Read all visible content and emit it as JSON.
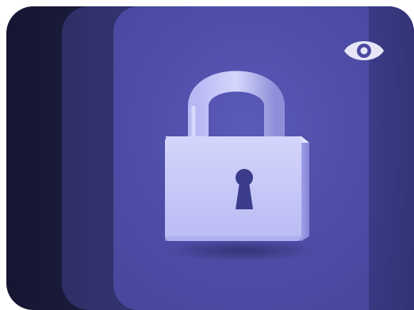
{
  "icons": {
    "lock": "lock-icon",
    "eye": "eye-icon"
  },
  "colors": {
    "background_dark": "#1a1a3a",
    "panel_front": "#5252ae",
    "lock_body": "#c8c9f8",
    "lock_shackle": "#a9aaee",
    "keyhole": "#3b3d8c",
    "eye": "#e6e6f8"
  }
}
